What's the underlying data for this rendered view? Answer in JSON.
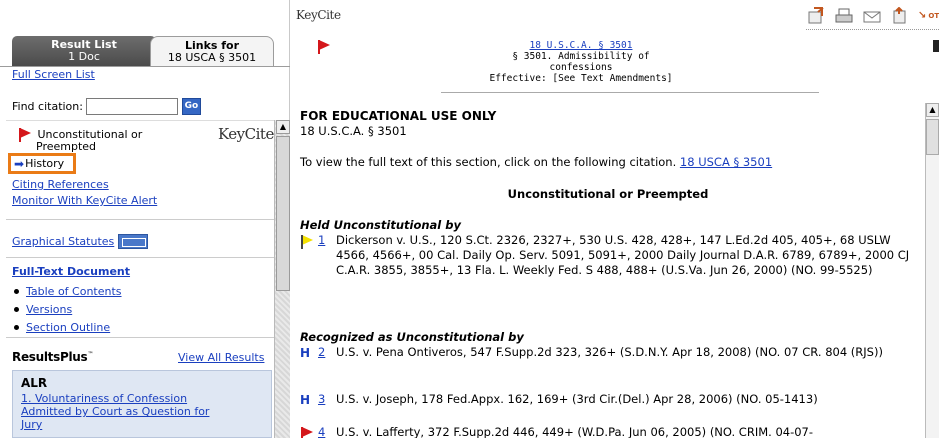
{
  "left": {
    "tabs": {
      "result_list_title": "Result List",
      "result_list_sub": "1 Doc",
      "links_title": "Links for",
      "links_sub": "18 USCA § 3501"
    },
    "full_screen_list": "Full Screen List",
    "find_citation_label": "Find citation:",
    "find_citation_value": "",
    "go_label": "Go",
    "keycite_logo": "KeyCite",
    "status_line1": "Unconstitutional or",
    "status_line2": "Preempted",
    "history": "History",
    "citing_references": "Citing References",
    "monitor": "Monitor With KeyCite Alert",
    "graphical_statutes": "Graphical Statutes",
    "full_text_document": "Full-Text Document",
    "full_text_items": [
      "Table of Contents",
      "Versions",
      "Section Outline"
    ],
    "resultsplus": "ResultsPlus",
    "resultsplus_tm": "™",
    "view_all_results": "View All Results",
    "alr": {
      "heading": "ALR",
      "link_line1": "1. Voluntariness of Confession",
      "link_line2": "Admitted by Court as Question for",
      "link_line3": "Jury"
    }
  },
  "right": {
    "keycite_logo": "KeyCite",
    "toolbar": {
      "icons": [
        "download-icon",
        "print-icon",
        "email-icon",
        "save-icon"
      ],
      "other_label": "OTHER"
    },
    "citation_head": {
      "link": "18 U.S.C.A. § 3501",
      "line2": "§ 3501. Admissibility of confessions",
      "line3": "Effective: [See Text Amendments]"
    },
    "doc": {
      "edu": "FOR EDUCATIONAL USE ONLY",
      "statute": "18 U.S.C.A. § 3501",
      "to_view_text": "To view the full text of this section, click on the following citation.",
      "to_view_link": "18 USCA § 3501",
      "section_title": "Unconstitutional or Preempted",
      "held_label": "Held Unconstitutional by",
      "recognized_label": "Recognized as Unconstitutional by",
      "entries": [
        {
          "num": "1",
          "text": "Dickerson v. U.S., 120 S.Ct. 2326, 2327+, 530 U.S. 428, 428+, 147 L.Ed.2d 405, 405+, 68 USLW 4566, 4566+, 00 Cal. Daily Op. Serv. 5091, 5091+, 2000 Daily Journal D.A.R. 6789, 6789+, 2000 CJ C.A.R. 3855, 3855+, 13 Fla. L. Weekly Fed. S 488, 488+ (U.S.Va. Jun 26, 2000) (NO. 99-5525)"
        },
        {
          "num": "2",
          "text": "U.S. v. Pena Ontiveros, 547 F.Supp.2d 323, 326+ (S.D.N.Y. Apr 18, 2008) (NO. 07 CR. 804 (RJS))"
        },
        {
          "num": "3",
          "text": "U.S. v. Joseph, 178 Fed.Appx. 162, 169+ (3rd Cir.(Del.) Apr 28, 2006) (NO. 05-1413)"
        },
        {
          "num": "4",
          "text": "U.S. v. Lafferty, 372 F.Supp.2d 446, 449+ (W.D.Pa. Jun 06, 2005) (NO. CRIM. 04-07-"
        }
      ]
    }
  }
}
